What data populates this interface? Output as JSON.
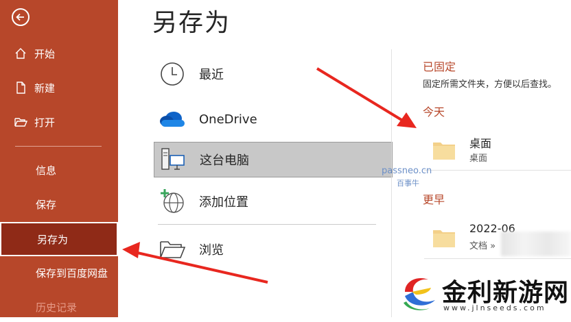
{
  "sidebar": {
    "items": [
      {
        "label": "开始",
        "icon": "home-icon"
      },
      {
        "label": "新建",
        "icon": "new-document-icon"
      },
      {
        "label": "打开",
        "icon": "open-folder-icon"
      },
      {
        "label": "信息"
      },
      {
        "label": "保存"
      },
      {
        "label": "另存为"
      },
      {
        "label": "保存到百度网盘"
      },
      {
        "label": "历史记录"
      }
    ]
  },
  "main": {
    "title": "另存为",
    "locations": [
      {
        "label": "最近",
        "icon": "clock-icon"
      },
      {
        "label": "OneDrive",
        "icon": "cloud-icon"
      },
      {
        "label": "这台电脑",
        "icon": "computer-icon"
      },
      {
        "label": "添加位置",
        "icon": "add-globe-icon"
      },
      {
        "label": "浏览",
        "icon": "open-folder-icon"
      }
    ]
  },
  "right": {
    "pinned_title": "已固定",
    "pinned_note": "固定所需文件夹，方便以后查找。",
    "today_title": "今天",
    "earlier_title": "更早",
    "today_folders": [
      {
        "name": "桌面",
        "path": "桌面"
      }
    ],
    "earlier_folders": [
      {
        "name": "2022-06",
        "path": "文档 »"
      }
    ]
  },
  "watermark": {
    "line1": "passneo.cn",
    "line2": "百事牛"
  },
  "logo": {
    "text": "金利新游网",
    "url": "www.jlnseeds.com"
  },
  "colors": {
    "accent": "#b7472a",
    "active": "#8f2a17",
    "arrow": "#e8271f"
  }
}
